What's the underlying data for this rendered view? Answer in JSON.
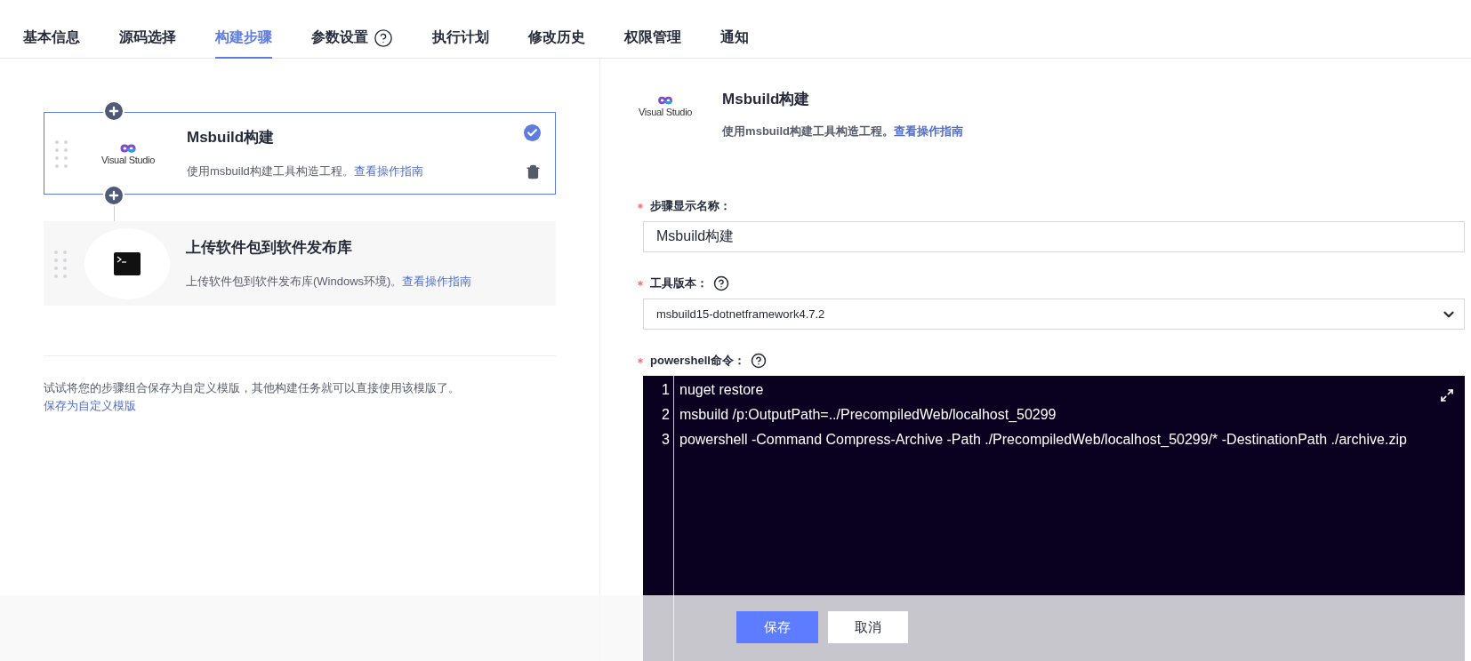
{
  "tabs": [
    {
      "label": "基本信息",
      "selected": false,
      "help": false
    },
    {
      "label": "源码选择",
      "selected": false,
      "help": false
    },
    {
      "label": "构建步骤",
      "selected": true,
      "help": false
    },
    {
      "label": "参数设置",
      "selected": false,
      "help": true
    },
    {
      "label": "执行计划",
      "selected": false,
      "help": false
    },
    {
      "label": "修改历史",
      "selected": false,
      "help": false
    },
    {
      "label": "权限管理",
      "selected": false,
      "help": false
    },
    {
      "label": "通知",
      "selected": false,
      "help": false
    }
  ],
  "steps": [
    {
      "kind": "visual-studio",
      "logo_text": "Visual Studio",
      "title": "Msbuild构建",
      "description": "使用msbuild构建工具构造工程。",
      "link": "查看操作指南",
      "selected": true
    },
    {
      "kind": "terminal",
      "title": "上传软件包到软件发布库",
      "description": "上传软件包到软件发布库(Windows环境)。",
      "link": "查看操作指南",
      "selected": false
    }
  ],
  "template_hint": {
    "text": "试试将您的步骤组合保存为自定义模版，其他构建任务就可以直接使用该模版了。",
    "link": "保存为自定义模版"
  },
  "detail": {
    "logo_text": "Visual Studio",
    "title": "Msbuild构建",
    "description": "使用msbuild构建工具构造工程。",
    "link": "查看操作指南",
    "fields": [
      {
        "kind": "text",
        "label": "步骤显示名称：",
        "required": true,
        "help": false,
        "value": "Msbuild构建"
      },
      {
        "kind": "select",
        "label": "工具版本：",
        "required": true,
        "help": true,
        "value": "msbuild15-dotnetframework4.7.2"
      },
      {
        "kind": "code",
        "label": "powershell命令：",
        "required": true,
        "help": true,
        "lines": [
          {
            "number": "1",
            "text": "nuget restore"
          },
          {
            "number": "2",
            "text": "msbuild /p:OutputPath=../PrecompiledWeb/localhost_50299"
          },
          {
            "number": "3",
            "text": "powershell -Command Compress-Archive -Path ./PrecompiledWeb/localhost_50299/* -DestinationPath ./archive.zip"
          }
        ]
      }
    ]
  },
  "footer": {
    "buttons": [
      {
        "label": "保存",
        "kind": "primary"
      },
      {
        "label": "取消",
        "kind": "default"
      }
    ]
  }
}
